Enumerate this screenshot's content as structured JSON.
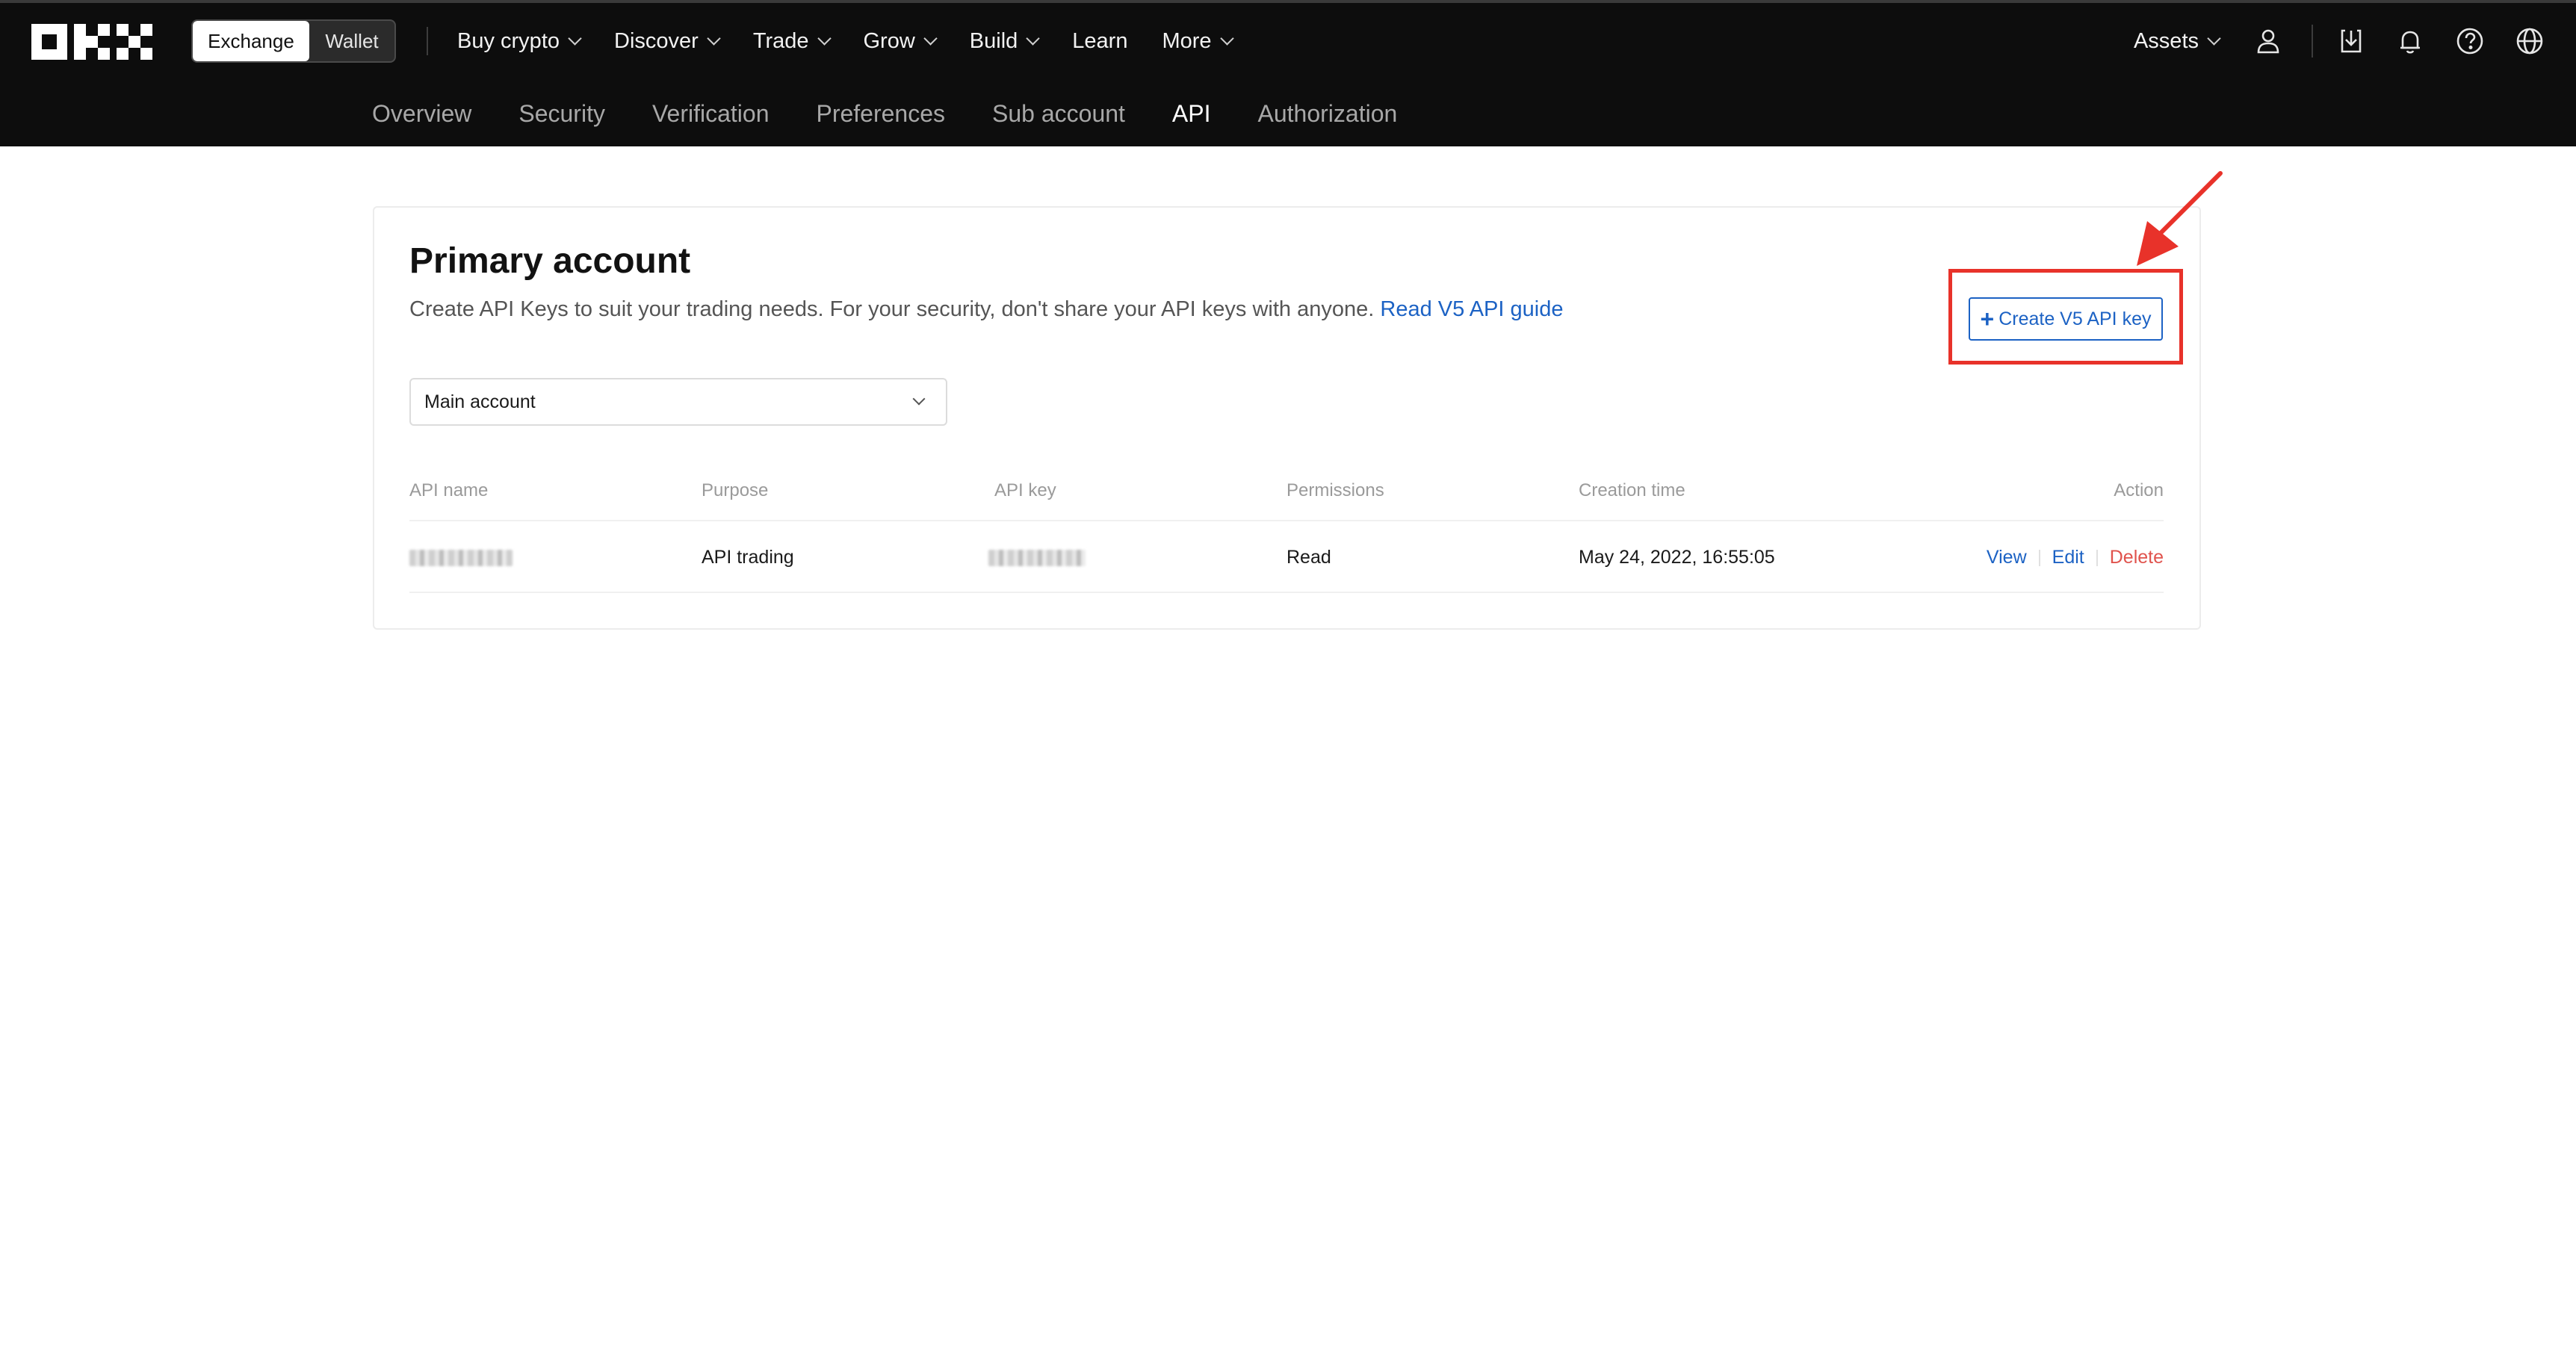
{
  "header": {
    "logo_alt": "OKX",
    "switch": {
      "exchange": "Exchange",
      "wallet": "Wallet",
      "active": "Exchange"
    },
    "nav": [
      {
        "label": "Buy crypto",
        "dropdown": true
      },
      {
        "label": "Discover",
        "dropdown": true
      },
      {
        "label": "Trade",
        "dropdown": true
      },
      {
        "label": "Grow",
        "dropdown": true
      },
      {
        "label": "Build",
        "dropdown": true
      },
      {
        "label": "Learn",
        "dropdown": false
      },
      {
        "label": "More",
        "dropdown": true
      }
    ],
    "assets_label": "Assets",
    "icons": [
      "user-icon",
      "download-icon",
      "bell-icon",
      "help-icon",
      "globe-icon"
    ]
  },
  "subnav": {
    "tabs": [
      "Overview",
      "Security",
      "Verification",
      "Preferences",
      "Sub account",
      "API",
      "Authorization"
    ],
    "active": "API"
  },
  "main": {
    "title": "Primary account",
    "description": "Create API Keys to suit your trading needs. For your security, don't share your API keys with anyone.",
    "guide_link": "Read V5 API guide",
    "create_button": "Create V5 API key",
    "account_select": {
      "value": "Main account"
    },
    "table": {
      "columns": [
        "API name",
        "Purpose",
        "API key",
        "Permissions",
        "Creation time",
        "Action"
      ],
      "rows": [
        {
          "api_name": "",
          "purpose": "API trading",
          "api_key": "",
          "permissions": "Read",
          "creation_time": "May 24, 2022, 16:55:05",
          "actions": [
            "View",
            "Edit",
            "Delete"
          ]
        }
      ]
    }
  },
  "colors": {
    "header_bg": "#0d0d0d",
    "link_blue": "#1c62c4",
    "delete_red": "#e0534d",
    "annotation_red": "#e8322a"
  }
}
